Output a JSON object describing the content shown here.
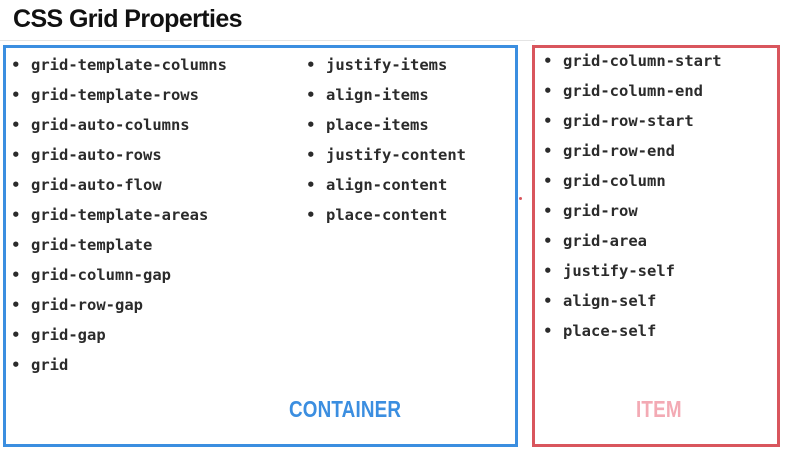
{
  "title": "CSS Grid Properties",
  "colors": {
    "container_border": "#3b8ee0",
    "item_border": "#d9565d",
    "container_label": "#3b8ee0",
    "item_label": "#f3aab4"
  },
  "bullet": "•",
  "container": {
    "label": "CONTAINER",
    "column_1": [
      "grid-template-columns",
      "grid-template-rows",
      "grid-auto-columns",
      "grid-auto-rows",
      "grid-auto-flow",
      "grid-template-areas",
      "grid-template",
      "grid-column-gap",
      "grid-row-gap",
      "grid-gap",
      "grid"
    ],
    "column_2": [
      "justify-items",
      "align-items",
      "place-items",
      "justify-content",
      "align-content",
      "place-content"
    ]
  },
  "item": {
    "label": "ITEM",
    "properties": [
      "grid-column-start",
      "grid-column-end",
      "grid-row-start",
      "grid-row-end",
      "grid-column",
      "grid-row",
      "grid-area",
      "justify-self",
      "align-self",
      "place-self"
    ]
  }
}
